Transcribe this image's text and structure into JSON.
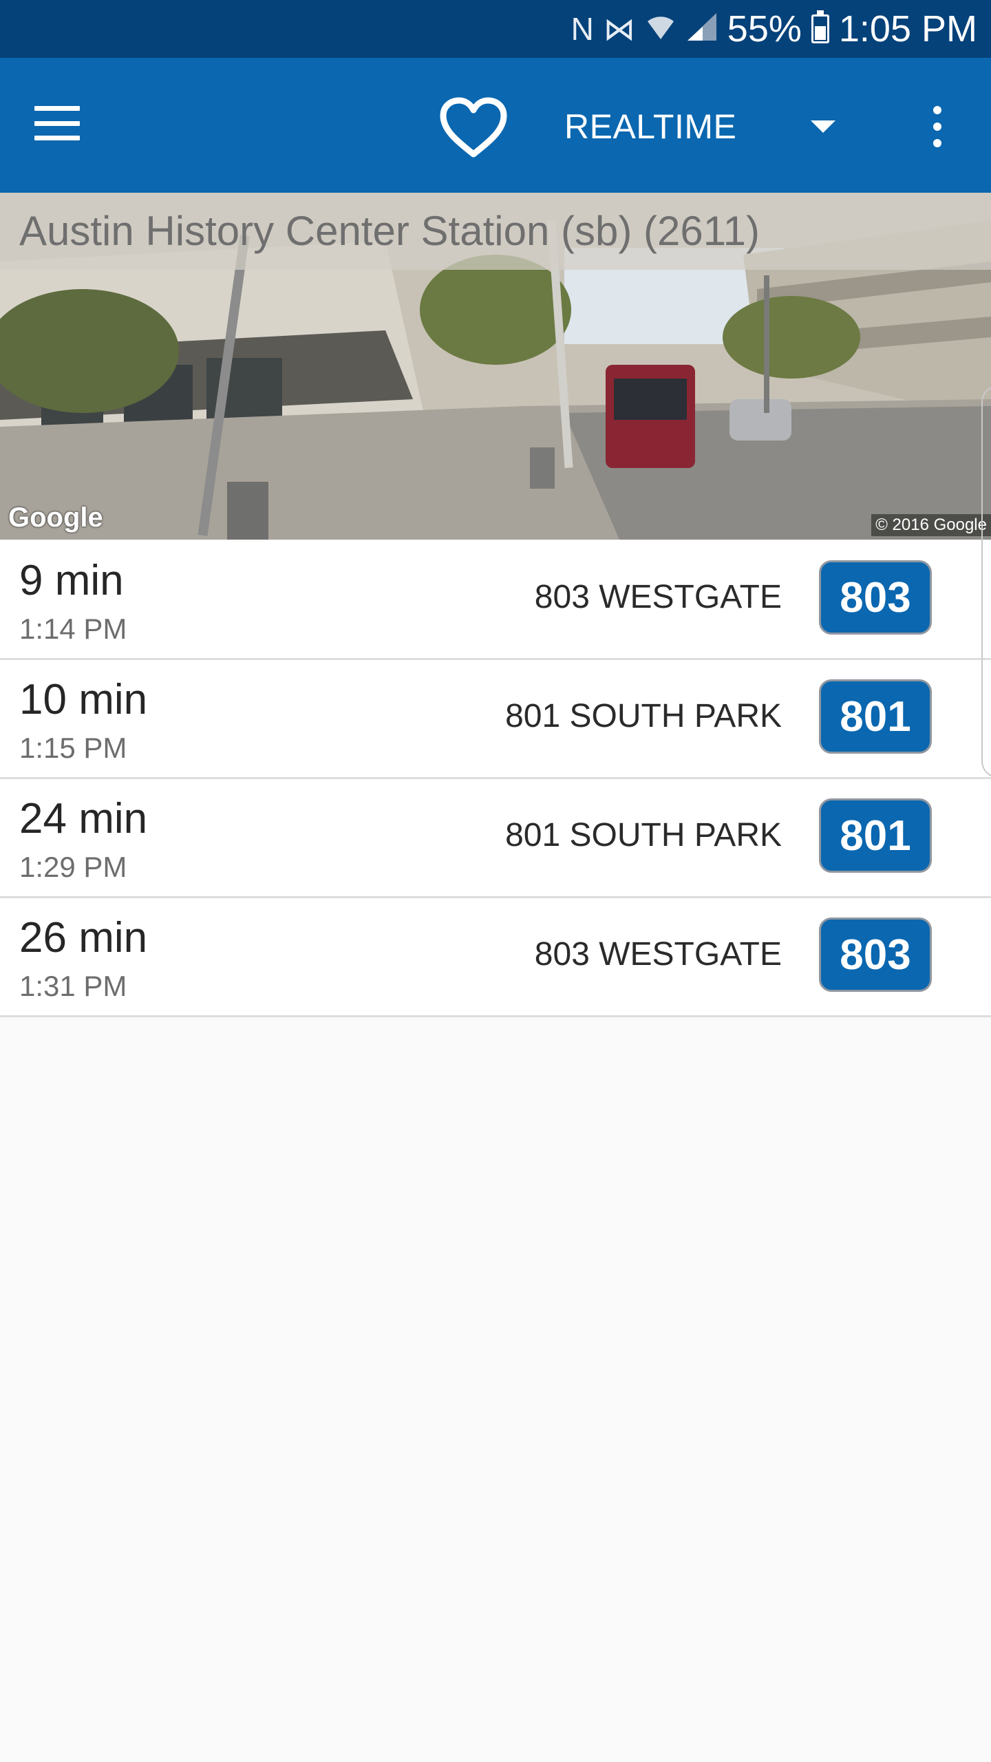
{
  "status_bar": {
    "icons": [
      "nfc-icon",
      "vibrate-off-icon",
      "wifi-icon",
      "cell-signal-icon",
      "battery-charging-icon"
    ],
    "battery": "55%",
    "time": "1:05 PM"
  },
  "app_bar": {
    "mode": "REALTIME",
    "colors": {
      "bar": "#0a67b0",
      "status": "#05427a"
    }
  },
  "station": {
    "name": "Austin History Center Station (sb) (2611)",
    "attribution_logo": "Google",
    "copyright": "© 2016 Google"
  },
  "arrivals": [
    {
      "minutes": "9 min",
      "time": "1:14 PM",
      "destination": "803 WESTGATE",
      "route": "803"
    },
    {
      "minutes": "10 min",
      "time": "1:15 PM",
      "destination": "801 SOUTH PARK",
      "route": "801"
    },
    {
      "minutes": "24 min",
      "time": "1:29 PM",
      "destination": "801 SOUTH PARK",
      "route": "801"
    },
    {
      "minutes": "26 min",
      "time": "1:31 PM",
      "destination": "803 WESTGATE",
      "route": "803"
    }
  ]
}
